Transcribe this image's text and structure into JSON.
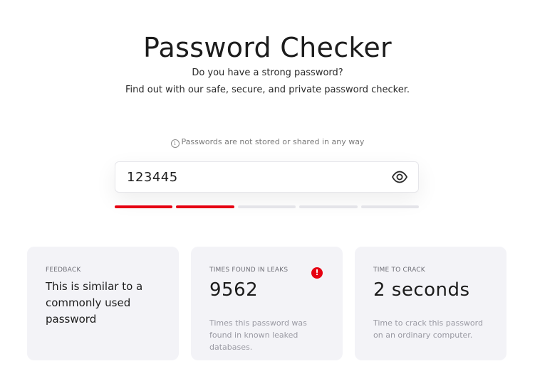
{
  "header": {
    "title": "Password Checker",
    "subtitle_line1": "Do you have a strong password?",
    "subtitle_line2": "Find out with our safe, secure, and private password checker."
  },
  "notice": {
    "icon": "info-icon",
    "text": "Passwords are not stored or shared in any way"
  },
  "password_field": {
    "value": "123445",
    "toggle_icon": "eye-icon"
  },
  "strength_meter": {
    "segments_total": 5,
    "segments_filled": 2,
    "fill_color": "#e60012",
    "empty_color": "#e4e4e9"
  },
  "cards": {
    "feedback": {
      "label": "FEEDBACK",
      "text": "This is similar to a commonly used password"
    },
    "leaks": {
      "label": "TIMES FOUND IN LEAKS",
      "value": "9562",
      "description": "Times this password was found in known leaked databases.",
      "alert_icon": "alert-icon",
      "alert_symbol": "!"
    },
    "crack": {
      "label": "TIME TO CRACK",
      "value": "2 seconds",
      "description": "Time to crack this password on an ordinary computer."
    }
  }
}
